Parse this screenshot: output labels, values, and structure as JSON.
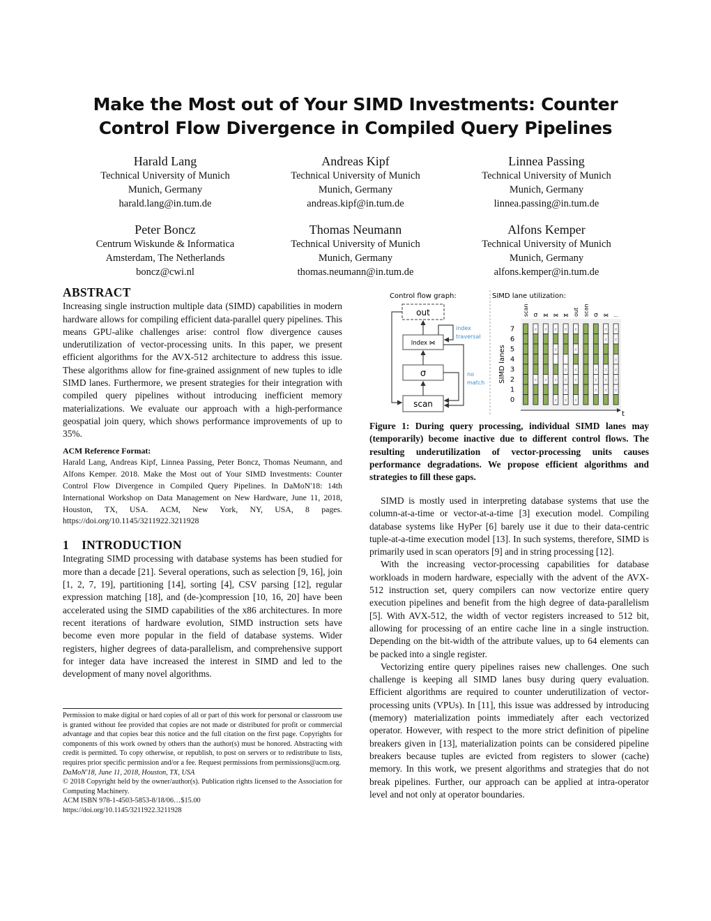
{
  "title": [
    "Make the Most out of Your SIMD Investments: Counter",
    "Control Flow Divergence in Compiled Query Pipelines"
  ],
  "authors": [
    {
      "name": "Harald Lang",
      "affiliation": "Technical University of Munich",
      "location": "Munich, Germany",
      "email": "harald.lang@in.tum.de"
    },
    {
      "name": "Andreas Kipf",
      "affiliation": "Technical University of Munich",
      "location": "Munich, Germany",
      "email": "andreas.kipf@in.tum.de"
    },
    {
      "name": "Linnea Passing",
      "affiliation": "Technical University of Munich",
      "location": "Munich, Germany",
      "email": "linnea.passing@in.tum.de"
    },
    {
      "name": "Peter Boncz",
      "affiliation": "Centrum Wiskunde & Informatica",
      "location": "Amsterdam, The Netherlands",
      "email": "boncz@cwi.nl"
    },
    {
      "name": "Thomas Neumann",
      "affiliation": "Technical University of Munich",
      "location": "Munich, Germany",
      "email": "thomas.neumann@in.tum.de"
    },
    {
      "name": "Alfons Kemper",
      "affiliation": "Technical University of Munich",
      "location": "Munich, Germany",
      "email": "alfons.kemper@in.tum.de"
    }
  ],
  "abstract": {
    "heading": "ABSTRACT",
    "text": "Increasing single instruction multiple data (SIMD) capabilities in modern hardware allows for compiling efficient data-parallel query pipelines. This means GPU-alike challenges arise: control flow divergence causes underutilization of vector-processing units. In this paper, we present efficient algorithms for the AVX-512 architecture to address this issue. These algorithms allow for fine-grained assignment of new tuples to idle SIMD lanes. Furthermore, we present strategies for their integration with compiled query pipelines without introducing inefficient memory materializations. We evaluate our approach with a high-performance geospatial join query, which shows performance improvements of up to 35%."
  },
  "acm_reference": {
    "heading": "ACM Reference Format:",
    "text": "Harald Lang, Andreas Kipf, Linnea Passing, Peter Boncz, Thomas Neumann, and Alfons Kemper. 2018. Make the Most out of Your SIMD Investments: Counter Control Flow Divergence in Compiled Query Pipelines. In DaMoN'18: 14th International Workshop on Data Management on New Hardware, June 11, 2018, Houston, TX, USA. ACM, New York, NY, USA, 8 pages. https://doi.org/10.1145/3211922.3211928"
  },
  "introduction": {
    "number": "1",
    "heading": "INTRODUCTION",
    "paragraphs": [
      "Integrating SIMD processing with database systems has been studied for more than a decade [21]. Several operations, such as selection [9, 16], join [1, 2, 7, 19], partitioning [14], sorting [4], CSV parsing [12], regular expression matching [18], and (de-)compression [10, 16, 20] have been accelerated using the SIMD capabilities of the x86 architectures. In more recent iterations of hardware evolution, SIMD instruction sets have become even more popular in the field of database systems. Wider registers, higher degrees of data-parallelism, and comprehensive support for integer data have increased the interest in SIMD and led to the development of many novel algorithms."
    ]
  },
  "footnote": {
    "permission": "Permission to make digital or hard copies of all or part of this work for personal or classroom use is granted without fee provided that copies are not made or distributed for profit or commercial advantage and that copies bear this notice and the full citation on the first page. Copyrights for components of this work owned by others than the author(s) must be honored. Abstracting with credit is permitted. To copy otherwise, or republish, to post on servers or to redistribute to lists, requires prior specific permission and/or a fee. Request permissions from permissions@acm.org.",
    "venue": "DaMoN'18, June 11, 2018, Houston, TX, USA",
    "copyright": "© 2018 Copyright held by the owner/author(s). Publication rights licensed to the Association for Computing Machinery.",
    "isbn": "ACM ISBN 978-1-4503-5853-8/18/06…$15.00",
    "doi": "https://doi.org/10.1145/3211922.3211928"
  },
  "figure": {
    "cfg_title": "Control flow graph:",
    "lanes_title": "SIMD lane utilization:",
    "nodes": {
      "out": "out",
      "index": "Index ⋈",
      "select": "σ",
      "scan": "scan"
    },
    "edge_labels": {
      "index_traversal": [
        "index",
        "traversal"
      ],
      "no_match": [
        "no",
        "match"
      ]
    },
    "lane_axis_label": "SIMD lanes",
    "time_axis_label": "t",
    "lanes": [
      "0",
      "1",
      "2",
      "3",
      "4",
      "5",
      "6",
      "7"
    ],
    "columns": [
      {
        "op": "scan",
        "lanes_top_to_bottom": "GGGGGGGG"
      },
      {
        "op": "σ",
        "lanes_top_to_bottom": "XGGGGXGG"
      },
      {
        "op": "⋈",
        "lanes_top_to_bottom": "XGGGGXGG"
      },
      {
        "op": "⋈",
        "lanes_top_to_bottom": "XGXWGXGX"
      },
      {
        "op": "⋈",
        "lanes_top_to_bottom": "XGGWXXXX"
      },
      {
        "op": "out",
        "lanes_top_to_bottom": "XGXGXXGX"
      },
      {
        "op": "scan",
        "lanes_top_to_bottom": "GGGGGGGG"
      },
      {
        "op": "σ",
        "lanes_top_to_bottom": "GGGGXXXG"
      },
      {
        "op": "⋈",
        "lanes_top_to_bottom": "XXGGXXXG"
      },
      {
        "op": "…",
        "lanes_top_to_bottom": "XXGXXXXG"
      }
    ],
    "colors": {
      "active": "#8faf5a",
      "inactive": "#ffffff",
      "label_blue": "#3a8fd0",
      "background": "#f0f0f0"
    },
    "caption": "Figure 1: During query processing, individual SIMD lanes may (temporarily) become inactive due to different control flows. The resulting underutilization of vector-processing units causes performance degradations. We propose efficient algorithms and strategies to fill these gaps."
  },
  "right_column": {
    "paragraphs": [
      "SIMD is mostly used in interpreting database systems that use the column-at-a-time or vector-at-a-time [3] execution model. Compiling database systems like HyPer [6] barely use it due to their data-centric tuple-at-a-time execution model [13]. In such systems, therefore, SIMD is primarily used in scan operators [9] and in string processing [12].",
      "With the increasing vector-processing capabilities for database workloads in modern hardware, especially with the advent of the AVX-512 instruction set, query compilers can now vectorize entire query execution pipelines and benefit from the high degree of data-parallelism [5]. With AVX-512, the width of vector registers increased to 512 bit, allowing for processing of an entire cache line in a single instruction. Depending on the bit-width of the attribute values, up to 64 elements can be packed into a single register.",
      "Vectorizing entire query pipelines raises new challenges. One such challenge is keeping all SIMD lanes busy during query evaluation. Efficient algorithms are required to counter underutilization of vector-processing units (VPUs). In [11], this issue was addressed by introducing (memory) materialization points immediately after each vectorized operator. However, with respect to the more strict definition of pipeline breakers given in [13], materialization points can be considered pipeline breakers because tuples are evicted from registers to slower (cache) memory. In this work, we present algorithms and strategies that do not break pipelines. Further, our approach can be applied at intra-operator level and not only at operator boundaries."
    ]
  }
}
